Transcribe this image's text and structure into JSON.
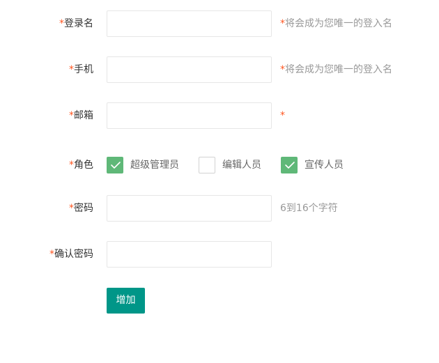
{
  "colors": {
    "required_mark": "#ff5722",
    "checkbox_checked": "#5fb878",
    "primary_button": "#009688",
    "hint_text": "#999999",
    "input_border": "#e6e6e6"
  },
  "form": {
    "username": {
      "required": "*",
      "label": "登录名",
      "value": "",
      "hint_required": "*",
      "hint": "将会成为您唯一的登入名"
    },
    "phone": {
      "required": "*",
      "label": "手机",
      "value": "",
      "hint_required": "*",
      "hint": "将会成为您唯一的登入名"
    },
    "email": {
      "required": "*",
      "label": "邮箱",
      "value": "",
      "hint_required": "*"
    },
    "role": {
      "required": "*",
      "label": "角色",
      "options": [
        {
          "label": "超级管理员",
          "checked": true,
          "icon": "check-icon"
        },
        {
          "label": "编辑人员",
          "checked": false,
          "icon": ""
        },
        {
          "label": "宣传人员",
          "checked": true,
          "icon": "check-icon"
        }
      ]
    },
    "password": {
      "required": "*",
      "label": "密码",
      "value": "",
      "hint": "6到16个字符"
    },
    "confirm_password": {
      "required": "*",
      "label": "确认密码",
      "value": ""
    },
    "submit_label": "增加"
  }
}
